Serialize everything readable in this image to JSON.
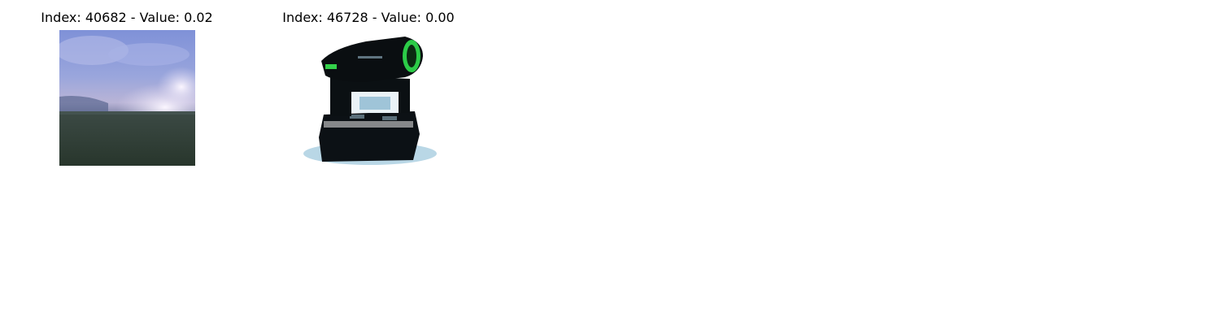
{
  "panels": [
    {
      "title": "Index: 40682 - Value: 0.02",
      "image": "landscape-sky-field"
    },
    {
      "title": "Index: 46728 - Value: 0.00",
      "image": "moving-head-stage-light"
    }
  ],
  "colors": {
    "background": "#ffffff",
    "sky": "#8ea0dc",
    "cloud": "#e8e4f4",
    "field": "#2e3b33",
    "device_body": "#0b0f12",
    "device_accent": "#33d14a",
    "device_base_shadow": "#9fc3d6"
  }
}
